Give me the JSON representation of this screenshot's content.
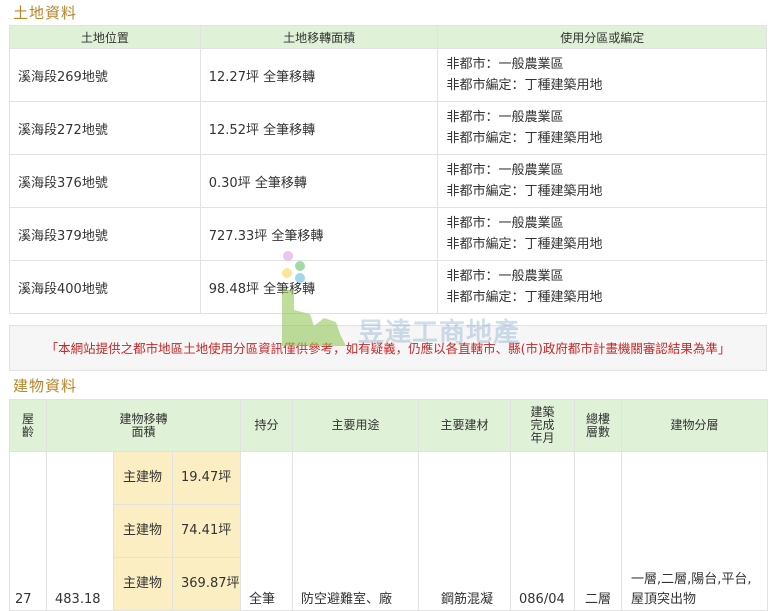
{
  "land": {
    "title": "土地資料",
    "headers": [
      "土地位置",
      "土地移轉面積",
      "使用分區或編定"
    ],
    "rows": [
      {
        "location": "溪海段269地號",
        "area": "12.27坪 全筆移轉",
        "zone1": "非都市：一般農業區",
        "zone2": "非都市編定：丁種建築用地"
      },
      {
        "location": "溪海段272地號",
        "area": "12.52坪 全筆移轉",
        "zone1": "非都市：一般農業區",
        "zone2": "非都市編定：丁種建築用地"
      },
      {
        "location": "溪海段376地號",
        "area": "0.30坪 全筆移轉",
        "zone1": "非都市：一般農業區",
        "zone2": "非都市編定：丁種建築用地"
      },
      {
        "location": "溪海段379地號",
        "area": "727.33坪 全筆移轉",
        "zone1": "非都市：一般農業區",
        "zone2": "非都市編定：丁種建築用地"
      },
      {
        "location": "溪海段400地號",
        "area": "98.48坪 全筆移轉",
        "zone1": "非都市：一般農業區",
        "zone2": "非都市編定：丁種建築用地"
      }
    ]
  },
  "notice": "「本網站提供之都市地區土地使用分區資訊僅供參考，如有疑義，仍應以各直轄市、縣(市)政府都市計畫機關審認結果為準」",
  "watermark": "昱達工商地產",
  "building": {
    "title": "建物資料",
    "headers": {
      "age": "屋齡",
      "area": "建物移轉面積",
      "share": "持分",
      "use": "主要用途",
      "material": "主要建材",
      "completed": "建築完成年月",
      "floors": "總樓層數",
      "layers": "建物分層"
    },
    "row": {
      "age": "27",
      "total_area": "483.18",
      "share": "全筆",
      "use": "防空避難室、廠",
      "material": "鋼筋混凝",
      "completed": "086/04",
      "floors": "二層",
      "layers": "一層,二層,陽台,平台,屋頂突出物"
    },
    "sub_items": [
      {
        "type": "主建物",
        "area": "19.47坪"
      },
      {
        "type": "主建物",
        "area": "74.41坪"
      },
      {
        "type": "主建物",
        "area": "369.87坪"
      }
    ]
  }
}
